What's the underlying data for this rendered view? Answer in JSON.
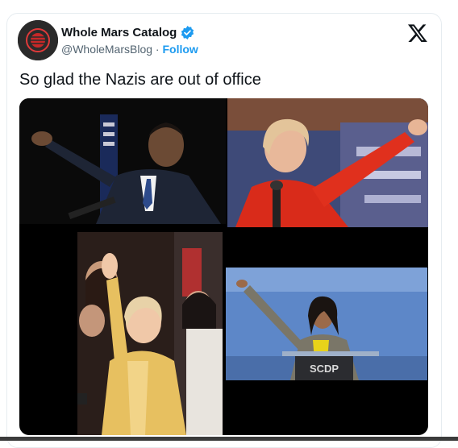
{
  "tweet": {
    "author_name": "Whole Mars Catalog",
    "handle": "@WholeMarsBlog",
    "separator": "·",
    "follow_label": "Follow",
    "text": "So glad the Nazis are out of office",
    "verified": true,
    "brand_icon": "x-logo-icon",
    "accent_color": "#1d9bf0"
  },
  "media": {
    "photo_count": 4,
    "podium_sign": "SCDP"
  }
}
